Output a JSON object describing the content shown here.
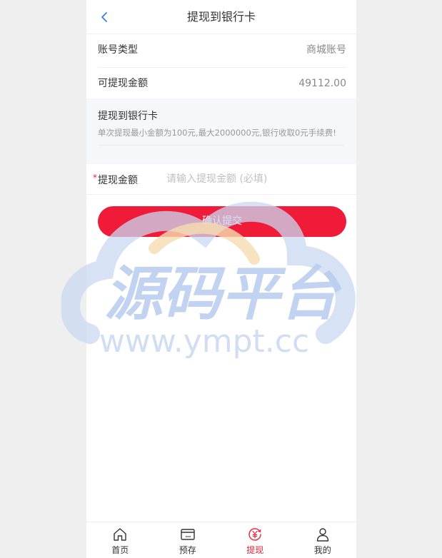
{
  "header": {
    "title": "提现到银行卡"
  },
  "account": {
    "label": "账号类型",
    "value": "商城账号"
  },
  "balance": {
    "label": "可提现金额",
    "value": "49112.00"
  },
  "info": {
    "title": "提现到银行卡",
    "note": "单次提现最小金额为100元,最大2000000元,银行收取0元手续费!"
  },
  "amount": {
    "required_mark": "*",
    "label": "提现金额",
    "placeholder": "请输入提现金额 (必填)"
  },
  "submit": {
    "label": "确认提交"
  },
  "watermark": {
    "title": "源码平台",
    "url": "www.ympt.cc"
  },
  "tabbar": {
    "items": [
      {
        "label": "首页",
        "icon": "home-icon"
      },
      {
        "label": "预存",
        "icon": "card-icon"
      },
      {
        "label": "提现",
        "icon": "withdraw-icon",
        "active": true
      },
      {
        "label": "我的",
        "icon": "user-icon"
      }
    ]
  },
  "colors": {
    "accent": "#ef1b38",
    "back_arrow": "#3b7ddd"
  }
}
